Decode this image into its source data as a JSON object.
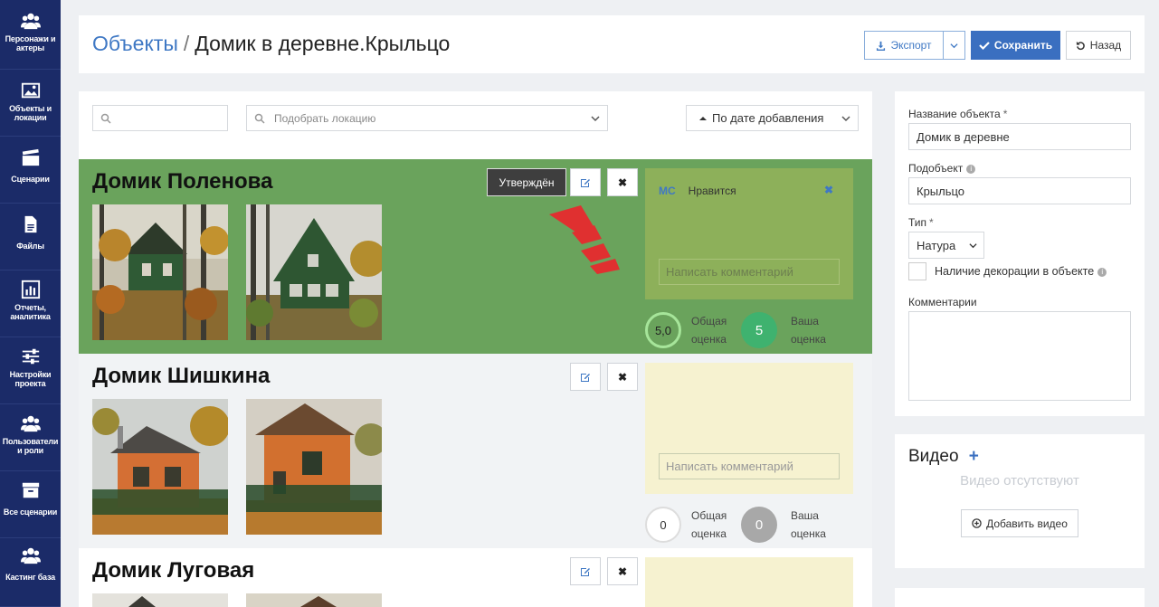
{
  "sidebar": {
    "items": [
      {
        "label": "Персонажи и актеры",
        "icon": "users-icon"
      },
      {
        "label": "Объекты и локации",
        "icon": "image-icon"
      },
      {
        "label": "Сценарии",
        "icon": "clapperboard-icon"
      },
      {
        "label": "Файлы",
        "icon": "file-icon"
      },
      {
        "label": "Отчеты, аналитика",
        "icon": "bar-chart-icon"
      },
      {
        "label": "Настройки проекта",
        "icon": "sliders-icon"
      },
      {
        "label": "Пользователи и роли",
        "icon": "users-icon"
      },
      {
        "label": "Все сценарии",
        "icon": "archive-icon"
      },
      {
        "label": "Кастинг база",
        "icon": "users-icon"
      }
    ]
  },
  "header": {
    "breadcrumb_link": "Объекты",
    "breadcrumb_sep": "/",
    "breadcrumb_current": "Домик в деревне.Крыльцо",
    "export_label": "Экспорт",
    "save_label": "Сохранить",
    "back_label": "Назад"
  },
  "filters": {
    "search_placeholder": "",
    "location_placeholder": "Подобрать локацию",
    "sort_label": "По дате добавления"
  },
  "cards": [
    {
      "title": "Домик Поленова",
      "status": "Утверждён",
      "comment_author": "МС",
      "comment_text": "Нравится",
      "comment_placeholder": "Написать комментарий",
      "overall_score": "5,0",
      "overall_label": "Общая оценка",
      "your_score": "5",
      "your_label": "Ваша оценка"
    },
    {
      "title": "Домик Шишкина",
      "comment_placeholder": "Написать комментарий",
      "overall_score": "0",
      "overall_label": "Общая оценка",
      "your_score": "0",
      "your_label": "Ваша оценка"
    },
    {
      "title": "Домик Луговая"
    }
  ],
  "form": {
    "name_label": "Название объекта",
    "name_value": "Домик в деревне",
    "subobject_label": "Подобъект",
    "subobject_value": "Крыльцо",
    "type_label": "Тип",
    "type_value": "Натура",
    "decor_label": "Наличие декорации в объекте",
    "comments_label": "Комментарии",
    "required_mark": "*"
  },
  "video": {
    "title": "Видео",
    "empty_text": "Видео отсутствуют",
    "add_label": "Добавить видео"
  },
  "colors": {
    "sidebar": "#1b2b68",
    "accent": "#3a6fc0",
    "approved_card": "#6aa35c",
    "comment_yellow": "#f6f2d0",
    "score_green": "#3fb26f"
  }
}
